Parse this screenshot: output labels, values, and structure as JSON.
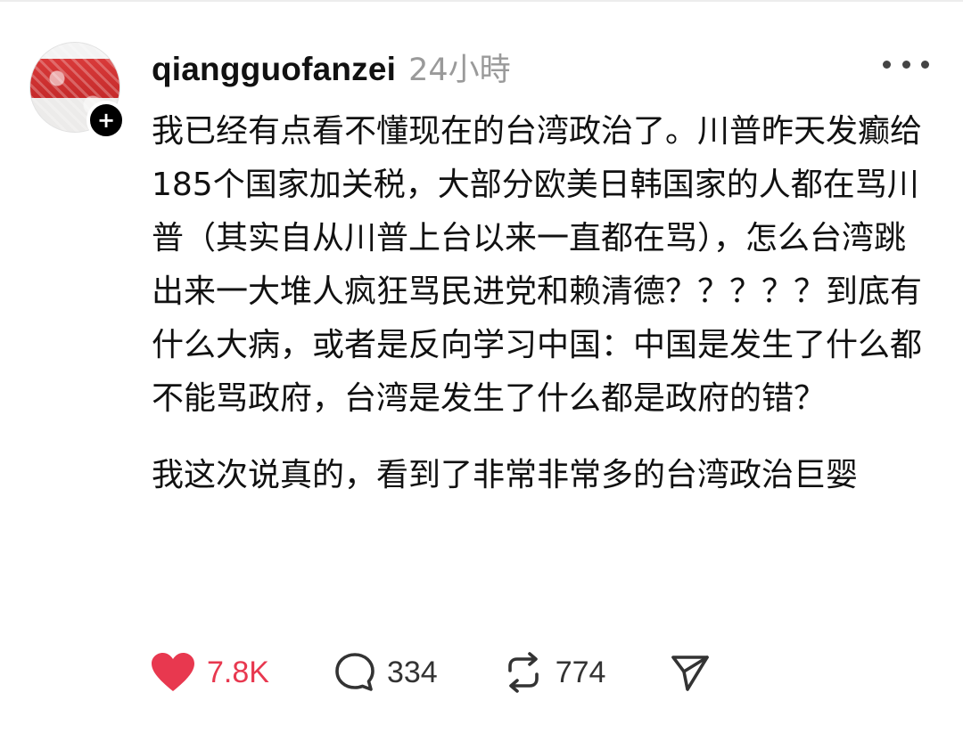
{
  "post": {
    "username": "qiangguofanzei",
    "timestamp": "24小時",
    "paragraph1": "我已经有点看不懂现在的台湾政治了。川普昨天发癫给185个国家加关税，大部分欧美日韩国家的人都在骂川普（其实自从川普上台以来一直都在骂），怎么台湾跳出来一大堆人疯狂骂民进党和赖清德？？？？？到底有什么大病，或者是反向学习中国：中国是发生了什么都不能骂政府，台湾是发生了什么都是政府的错？",
    "paragraph2": "我这次说真的，看到了非常非常多的台湾政治巨婴"
  },
  "actions": {
    "likes": "7.8K",
    "comments": "334",
    "reposts": "774"
  },
  "colors": {
    "like": "#e8384f",
    "text": "#111111",
    "muted": "#9a9a9a"
  },
  "icons": {
    "like": "heart-icon",
    "comment": "comment-bubble-icon",
    "repost": "repost-icon",
    "share": "send-icon",
    "more": "more-dots-icon",
    "follow": "plus-icon"
  }
}
